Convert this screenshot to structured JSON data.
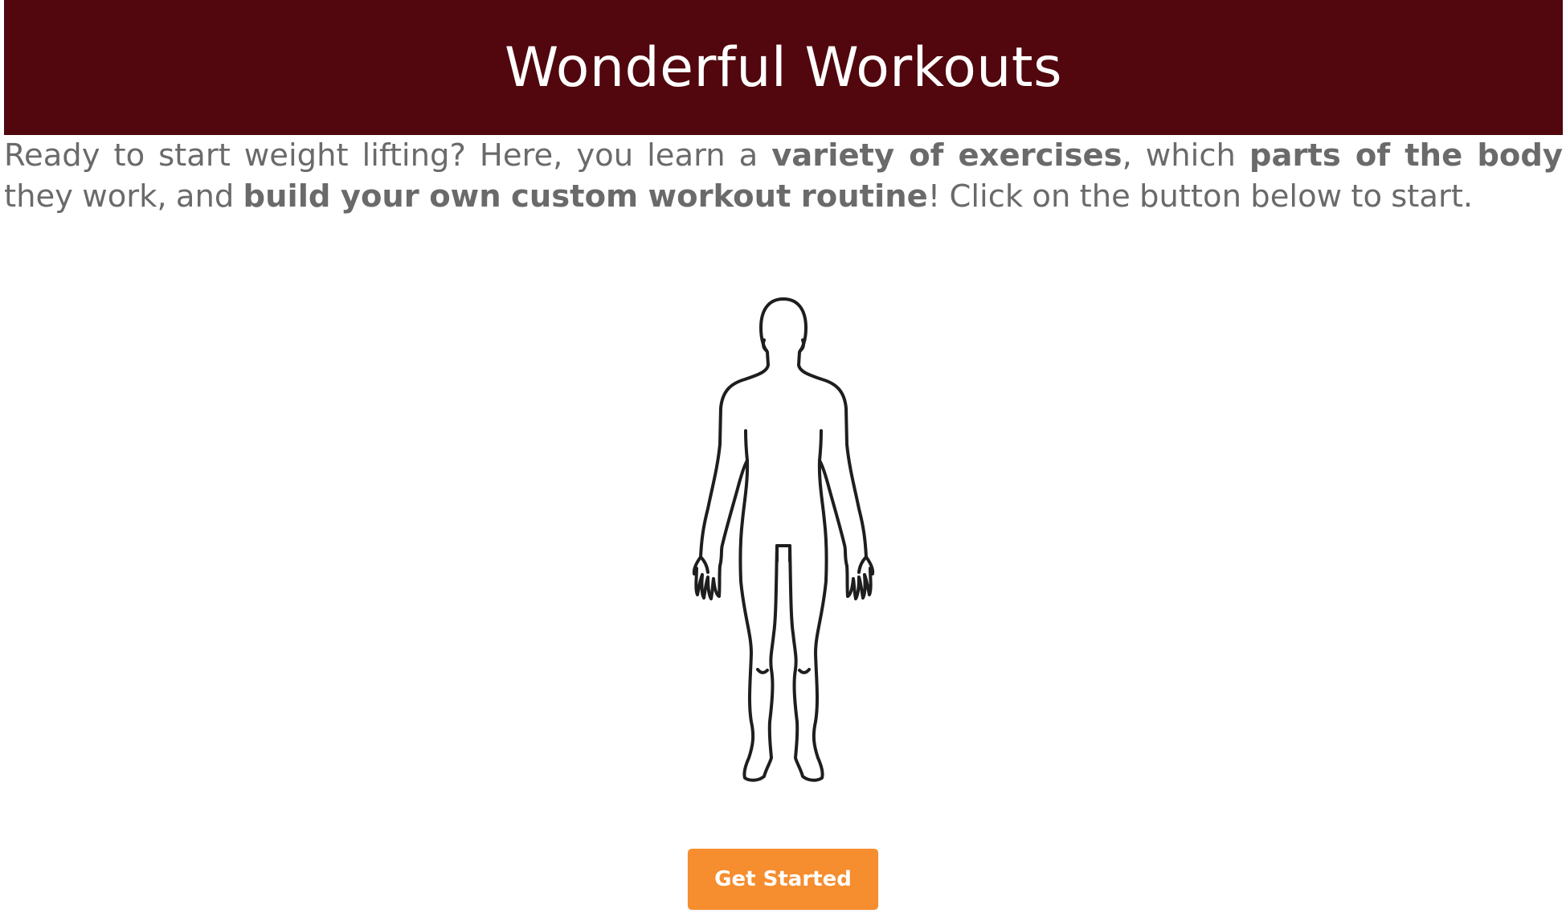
{
  "header": {
    "title": "Wonderful Workouts",
    "background_color": "#51070d"
  },
  "intro": {
    "part1": "Ready to start weight lifting? Here, you learn a ",
    "bold1": "variety of exercises",
    "part2": ", which ",
    "bold2": "parts of the body",
    "part3": " they work, and ",
    "bold3": "build your own custom workout routine",
    "part4": "! Click on the button below to start."
  },
  "illustration": {
    "icon": "human-body-outline-icon"
  },
  "cta": {
    "label": "Get Started",
    "color": "#f68d2e"
  }
}
